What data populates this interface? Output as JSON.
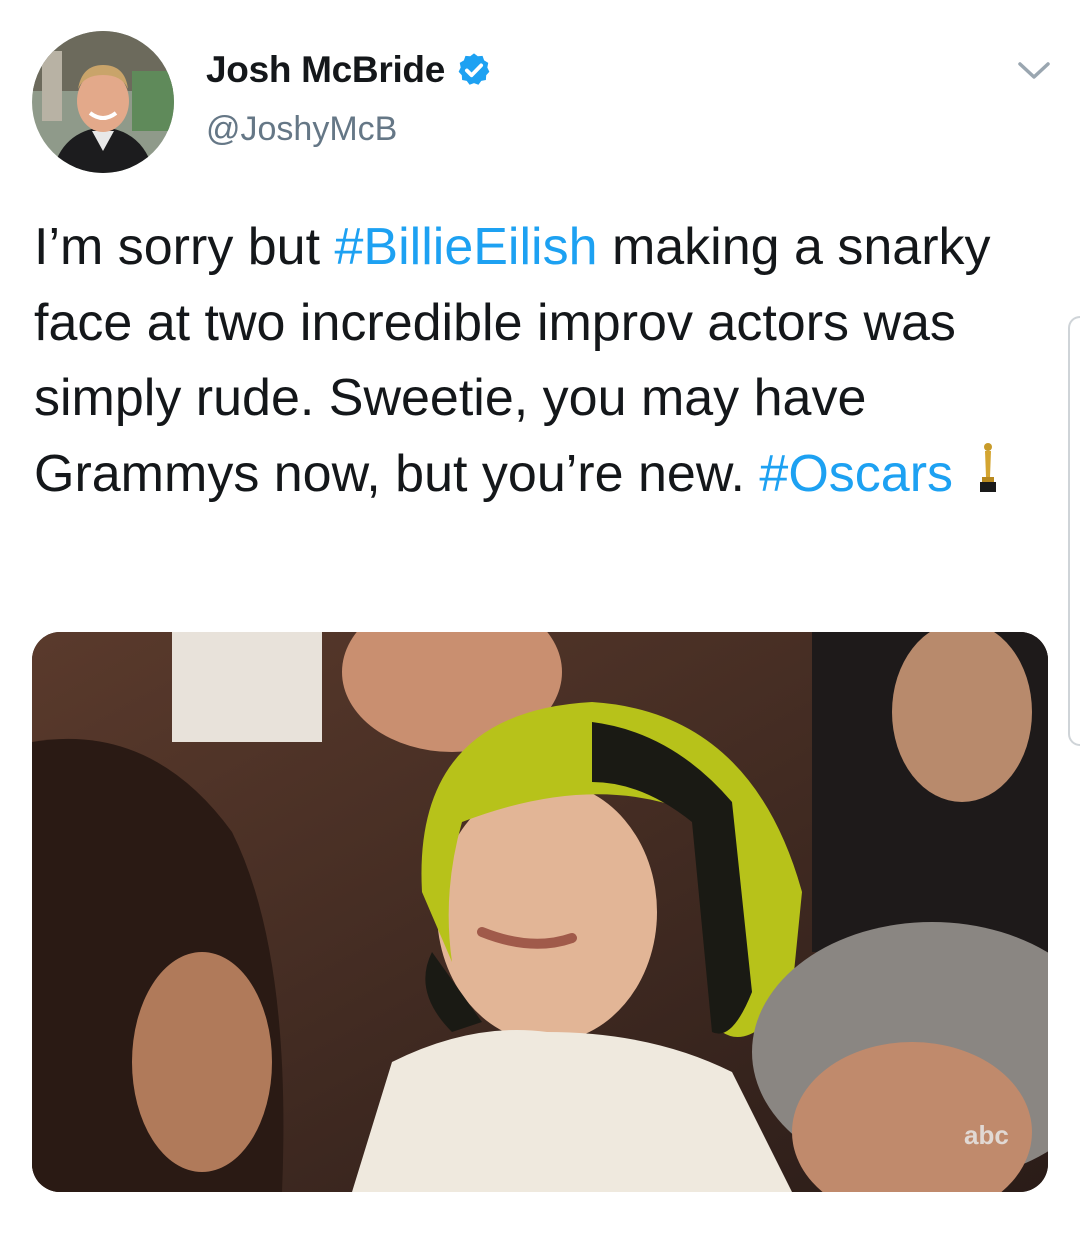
{
  "tweet": {
    "author": {
      "display_name": "Josh McBride",
      "handle": "@JoshyMcB",
      "verified": true,
      "avatar_icon": "profile-photo"
    },
    "text_segments": [
      {
        "text": "I’m sorry but ",
        "type": "plain"
      },
      {
        "text": "#BillieEilish",
        "type": "hashtag"
      },
      {
        "text": " making a snarky face at two incredible improv actors was simply rude. Sweetie, you may have Grammys now, but you’re new. ",
        "type": "plain"
      },
      {
        "text": "#Oscars",
        "type": "hashtag"
      }
    ],
    "emoji": "oscar-trophy-icon",
    "media": {
      "type": "photo",
      "watermark": "abc"
    },
    "menu_icon": "chevron-down-icon"
  },
  "colors": {
    "hashtag": "#1da1f2",
    "verified_badge": "#1da1f2",
    "handle": "#657786",
    "text": "#14171a",
    "hair_accent": "#b7c21a"
  }
}
